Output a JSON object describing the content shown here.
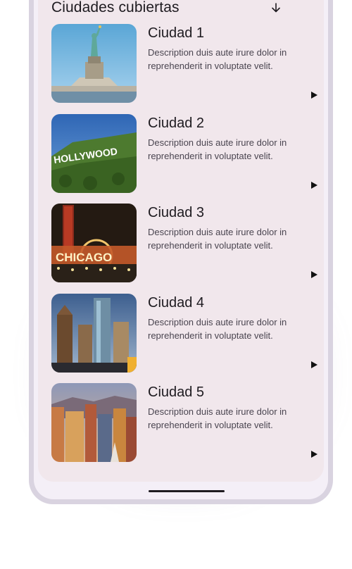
{
  "header": {
    "title": "Ciudades cubiertas",
    "sort_icon": "arrow-downward-icon"
  },
  "cities": [
    {
      "title": "Ciudad 1",
      "description": "Description duis aute irure dolor in reprehenderit in voluptate velit.",
      "image": "statue-of-liberty",
      "action_icon": "play-arrow-icon"
    },
    {
      "title": "Ciudad 2",
      "description": "Description duis aute irure dolor in reprehenderit in voluptate velit.",
      "image": "hollywood-sign",
      "image_text": "HOLLYWOOD",
      "action_icon": "play-arrow-icon"
    },
    {
      "title": "Ciudad 3",
      "description": "Description duis aute irure dolor in reprehenderit in voluptate velit.",
      "image": "chicago-theatre",
      "image_text": "CHICAGO",
      "action_icon": "play-arrow-icon"
    },
    {
      "title": "Ciudad 4",
      "description": "Description duis aute irure dolor in reprehenderit in voluptate velit.",
      "image": "houston-skyline",
      "action_icon": "play-arrow-icon"
    },
    {
      "title": "Ciudad 5",
      "description": "Description duis aute irure dolor in reprehenderit in voluptate velit.",
      "image": "city-skyline-sunset",
      "action_icon": "play-arrow-icon"
    }
  ],
  "colors": {
    "sheet_background": "#f1e7ec",
    "screen_background": "#f4eff7",
    "frame": "#d9d3e0",
    "text_primary": "#1e1b20",
    "text_secondary": "#4a4550"
  }
}
